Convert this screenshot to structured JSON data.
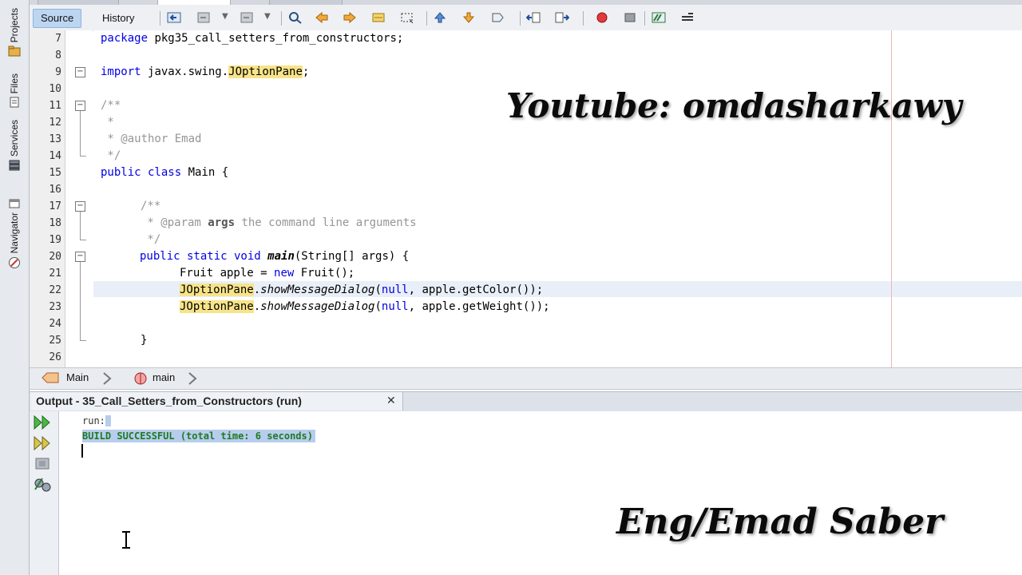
{
  "toolbar": {
    "source_label": "Source",
    "history_label": "History"
  },
  "sidebar": {
    "items": [
      {
        "label": "Projects",
        "icon": "projects-icon"
      },
      {
        "label": "Files",
        "icon": "files-icon"
      },
      {
        "label": "Services",
        "icon": "services-icon"
      },
      {
        "label": "Navigator",
        "icon": "navigator-icon"
      }
    ]
  },
  "editor": {
    "line_numbers": [
      "7",
      "8",
      "9",
      "10",
      "11",
      "12",
      "13",
      "14",
      "15",
      "16",
      "17",
      "18",
      "19",
      "20",
      "21",
      "22",
      "23",
      "24",
      "25",
      "26"
    ],
    "lines": {
      "l7": {
        "kw1": "package ",
        "rest": "pkg35_call_setters_from_constructors;"
      },
      "l9": {
        "kw1": "import ",
        "rest1": "javax.swing.",
        "hl": "JOptionPane",
        "rest2": ";"
      },
      "l11": "/**",
      "l12": " *",
      "l13": " * @author Emad",
      "l14": " */",
      "l15": {
        "kw1": "public class ",
        "rest": "Main {"
      },
      "l17": "/**",
      "l18": {
        "c1": " * @param ",
        "b": "args",
        "c2": " the command line arguments"
      },
      "l19": " */",
      "l20": {
        "kw1": "public static void ",
        "fn": "main",
        "rest": "(String[] args) {"
      },
      "l21": {
        "rest1": "Fruit apple = ",
        "kw": "new",
        "rest2": " Fruit();"
      },
      "l22": {
        "hl": "JOptionPane",
        "dot": ".",
        "fn": "showMessageDialog",
        "p1": "(",
        "kw": "null",
        "rest": ", apple.getColor());"
      },
      "l23": {
        "hl": "JOptionPane",
        "dot": ".",
        "fn": "showMessageDialog",
        "p1": "(",
        "kw": "null",
        "rest": ", apple.getWeight());"
      },
      "l25": "}"
    }
  },
  "breadcrumb": {
    "class_label": "Main",
    "method_label": "main"
  },
  "output": {
    "tab_title": "Output - 35_Call_Setters_from_Constructors (run)",
    "close_symbol": "✕",
    "lines": [
      "run:",
      "BUILD SUCCESSFUL (total time: 6 seconds)"
    ]
  },
  "watermarks": {
    "top": "Youtube: omdasharkawy",
    "bottom": "Eng/Emad Saber"
  },
  "colors": {
    "keyword": "#0000e6",
    "comment": "#969696",
    "highlight": "#f7e48a",
    "selection": "#b7cdee"
  }
}
